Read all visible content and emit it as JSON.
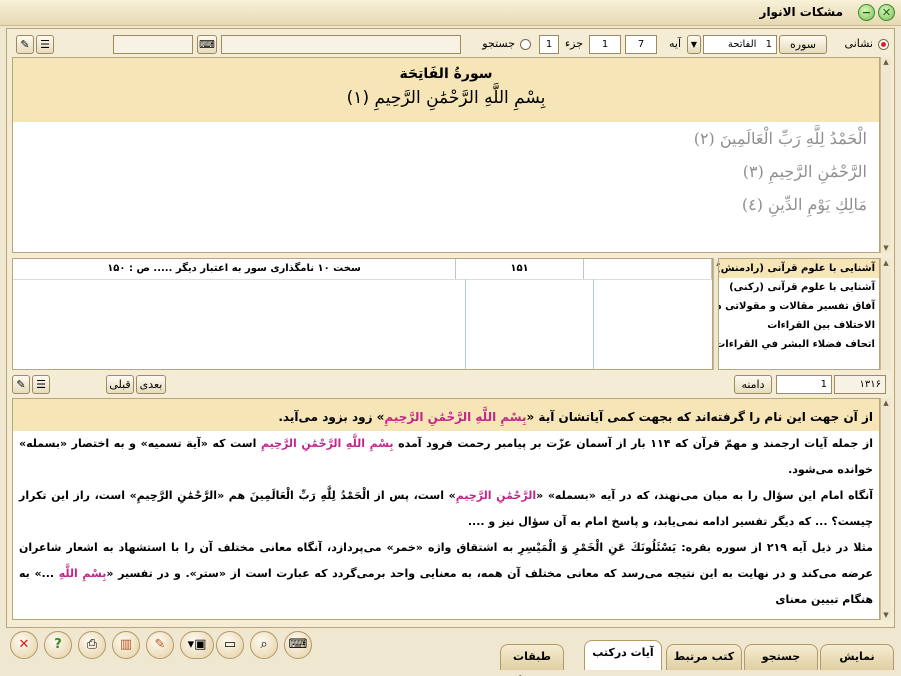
{
  "window": {
    "title": "مشکات الانوار"
  },
  "toolbar": {
    "show_label": "نشانی",
    "sura_label": "سوره",
    "sura_no": "1",
    "sura_name": "الفاتحة",
    "aya_label": "آیه",
    "aya_from": "7",
    "aya_to": "1",
    "juz_label": "جزء",
    "juz_value": "1",
    "search_label": "جستجو",
    "search_placeholder": ""
  },
  "quran": {
    "sura_title": "سورةُ الفَاتِحَة",
    "basmala": "بِسْمِ اللَّهِ الرَّحْمَٰنِ الرَّحِيمِ (١)",
    "ayat": [
      "الْحَمْدُ لِلَّهِ رَبِّ الْعَالَمِينَ (٢)",
      "الرَّحْمَٰنِ الرَّحِيمِ (٣)",
      "مَالِكِ يَوْمِ الدِّينِ (٤)"
    ]
  },
  "results": {
    "row": {
      "title": "سخت ۱۰ نامگذاری سور به اعتبار دیگر ..... ص : ۱۵۰",
      "number": "۱۵۱"
    }
  },
  "books": [
    "آشنایی با علوم قرآنی (رادمنش)",
    "آشنایی با علوم قرآنی (رکنی)",
    "آفاق تفسیر مقالات و مقولاتی در ...",
    "الاختلاف بین القراءات",
    "اتحاف فضلاء البشر في القراءات ..."
  ],
  "midbar": {
    "next_label": "بعدی",
    "prev_label": "قبلی",
    "tail_label": "دامنه",
    "page_value": "1",
    "total_value": "۱۳۱۶"
  },
  "commentary": {
    "p0_a": "از آن جهت این نام را گرفته‌اند که بجهت کمی آیاتشان آیة «",
    "p0_pink": "بِسْمِ اللَّهِ الرَّحْمَٰنِ الرَّحِيمِ",
    "p0_b": "» زود بزود می‌آید.",
    "p1_a": "از جمله آیات ارجمند و مهمّ قرآن که ۱۱۴ بار از آسمان عزّت بر پیامبر رحمت فرود آمده ",
    "p1_pink": "بِسْمِ اللَّهِ الرَّحْمَٰنِ الرَّحِيمِ",
    "p1_b": " است که «آیة تسمیه» و به اختصار «بسمله» خوانده می‌شود.",
    "p2_a": "آنگاه امام این سؤال را به میان می‌نهند، که در آیه «بسمله» «",
    "p2_pink": "الرَّحْمَٰنِ الرَّحِيمِ",
    "p2_b": "» است، پس از الْحَمْدُ لِلَّهِ رَبِّ الْعَالَمِينَ هم «الرَّحْمَٰنِ الرَّحِيمِ» است، راز این تکرار چیست؟ ... که دیگر تفسیر ادامه نمی‌یابد، و پاسخ امام به آن سؤال نیز و ....",
    "p3_a": "مثلا در ذیل آیه ۲۱۹ از سوره بقره: يَسْئَلُونَكَ عَنِ الْخَمْرِ وَ الْمَيْسِرِ به اشتقاق واژه «خمر» می‌پردازد، آنگاه معانی مختلف آن را با استشهاد به اشعار شاعران عرضه می‌کند و در نهایت به این نتیجه می‌رسد که معانی مختلف آن همه، به معنایی واحد برمی‌گردد که عبارت است از «ستر». و در تفسیر «",
    "p3_pink": "بِسْمِ اللَّهِ",
    "p3_b": " ...» به هنگام تبیین معنای"
  },
  "tabs": [
    "نمایش",
    "جستجو",
    "کتب مرتبط",
    "آیات درکتب",
    "طبقات مفسران"
  ],
  "colors": {
    "accent": "#f6e5b6",
    "highlight_text": "#c2268a",
    "window_bg": "#efe7cf"
  }
}
